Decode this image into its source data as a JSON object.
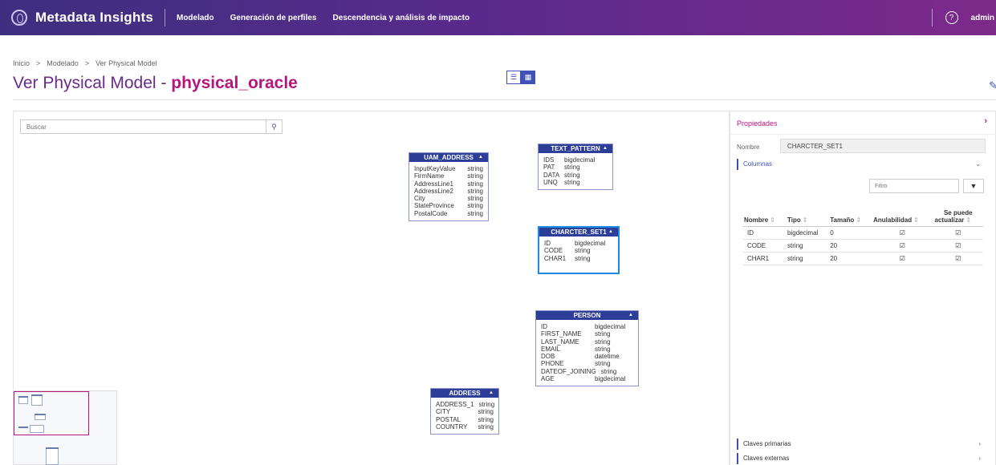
{
  "header": {
    "app_title": "Metadata Insights",
    "nav": [
      "Modelado",
      "Generación de perfiles",
      "Descendencia y análisis de impacto"
    ],
    "help_glyph": "?",
    "user": "admin"
  },
  "breadcrumb": [
    "Inicio",
    "Modelado",
    "Ver Physical Model"
  ],
  "page_title": {
    "prefix": "Ver Physical Model - ",
    "name": "physical_oracle"
  },
  "search": {
    "placeholder": "Buscar"
  },
  "entities": {
    "uam_address": {
      "name": "UAM_ADDRESS",
      "columns": [
        [
          "InputKeyValue",
          "string"
        ],
        [
          "FirmName",
          "string"
        ],
        [
          "AddressLine1",
          "string"
        ],
        [
          "AddressLine2",
          "string"
        ],
        [
          "City",
          "string"
        ],
        [
          "StateProvince",
          "string"
        ],
        [
          "PostalCode",
          "string"
        ]
      ]
    },
    "text_pattern": {
      "name": "TEXT_PATTERN",
      "columns": [
        [
          "IDS",
          "bigdecimal"
        ],
        [
          "PAT",
          "string"
        ],
        [
          "DATA",
          "string"
        ],
        [
          "UNQ",
          "string"
        ]
      ]
    },
    "charcter_set1": {
      "name": "CHARCTER_SET1",
      "columns": [
        [
          "ID",
          "bigdecimal"
        ],
        [
          "CODE",
          "string"
        ],
        [
          "CHAR1",
          "string"
        ]
      ]
    },
    "person": {
      "name": "PERSON",
      "columns": [
        [
          "ID",
          "bigdecimal"
        ],
        [
          "FIRST_NAME",
          "string"
        ],
        [
          "LAST_NAME",
          "string"
        ],
        [
          "EMAIL",
          "string"
        ],
        [
          "DOB",
          "datetime"
        ],
        [
          "PHONE",
          "string"
        ],
        [
          "DATEOF_JOINING",
          "string"
        ],
        [
          "AGE",
          "bigdecimal"
        ]
      ]
    },
    "address": {
      "name": "ADDRESS",
      "columns": [
        [
          "ADDRESS_1",
          "string"
        ],
        [
          "CITY",
          "string"
        ],
        [
          "POSTAL",
          "string"
        ],
        [
          "COUNTRY",
          "string"
        ]
      ]
    }
  },
  "properties": {
    "title": "Propiedades",
    "name_label": "Nombre",
    "name_value": "CHARCTER_SET1",
    "columns_section": "Columnas",
    "filter_placeholder": "Filtro",
    "table_headers": {
      "name": "Nombre",
      "type": "Tipo",
      "size": "Tamaño",
      "nullable": "Anulabilidad",
      "updatable_1": "Se puede",
      "updatable_2": "actualizar"
    },
    "rows": [
      {
        "name": "ID",
        "type": "bigdecimal",
        "size": "0",
        "nullable": true,
        "updatable": true
      },
      {
        "name": "CODE",
        "type": "string",
        "size": "20",
        "nullable": true,
        "updatable": true
      },
      {
        "name": "CHAR1",
        "type": "string",
        "size": "20",
        "nullable": true,
        "updatable": true
      }
    ],
    "primary_keys": "Claves primarias",
    "foreign_keys": "Claves externas"
  },
  "colors": {
    "accent": "#b5157d",
    "primary": "#3f51b5",
    "entity_header": "#2c3e97"
  }
}
